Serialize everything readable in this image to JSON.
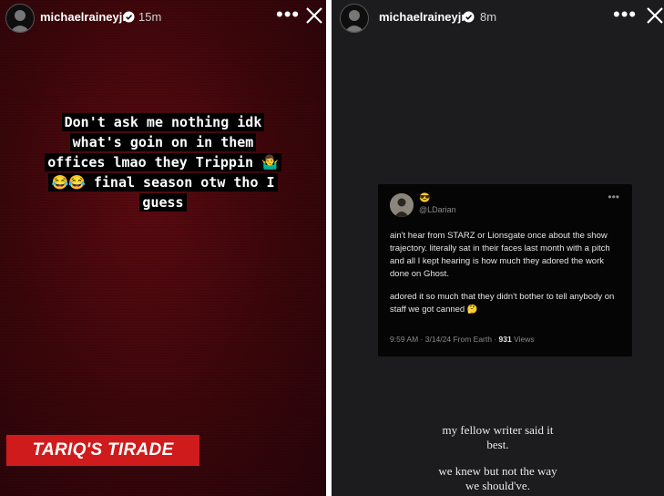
{
  "left_story": {
    "username": "michaelraineyjr",
    "time_ago": "15m",
    "caption_lines": [
      "Don't ask me nothing idk",
      "what's goin on in them",
      "offices lmao they Trippin 🤷‍♂️",
      "😂😂 final season otw tho I",
      "guess"
    ],
    "banner": "TARIQ'S TIRADE",
    "banner_color": "#cf1b1b"
  },
  "right_story": {
    "username": "michaelraineyjr",
    "time_ago": "8m",
    "tweet": {
      "display_name": "😎",
      "handle": "@LDarian",
      "paragraph_1": "ain't hear from STARZ or Lionsgate once about the show trajectory. literally sat in their faces last month with a pitch and all I kept hearing is how much they adored the work done on Ghost.",
      "paragraph_2": "adored it so much that they didn't bother to tell anybody on staff we got canned 🤔",
      "timestamp": "9:59 AM · 3/14/24 From Earth ·",
      "views_count": "931",
      "views_label": "Views"
    },
    "caption_lines": [
      "my fellow writer said it",
      "best.",
      "we knew but not the way",
      "we should've."
    ]
  }
}
